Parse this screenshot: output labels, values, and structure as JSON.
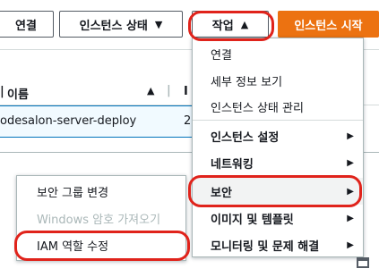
{
  "toolbar": {
    "connect": "연결",
    "instance_state": "인스턴스 상태",
    "actions": "작업",
    "launch": "인스턴스 시작"
  },
  "table": {
    "col_name": "이름",
    "col_next": "I",
    "row_name": "odesalon-server-deploy",
    "row_next": "2"
  },
  "menu": {
    "items": [
      {
        "label": "연결"
      },
      {
        "label": "세부 정보 보기"
      },
      {
        "label": "인스턴스 상태 관리"
      },
      {
        "label": "인스턴스 설정"
      },
      {
        "label": "네트워킹"
      },
      {
        "label": "보안"
      },
      {
        "label": "이미지 및 템플릿"
      },
      {
        "label": "모니터링 및 문제 해결"
      }
    ]
  },
  "submenu": {
    "items": [
      {
        "label": "보안 그룹 변경"
      },
      {
        "label": "Windows 암호 가져오기"
      },
      {
        "label": "IAM 역할 수정"
      }
    ]
  },
  "colors": {
    "accent": "#ec7211",
    "highlight": "#e0231b"
  }
}
